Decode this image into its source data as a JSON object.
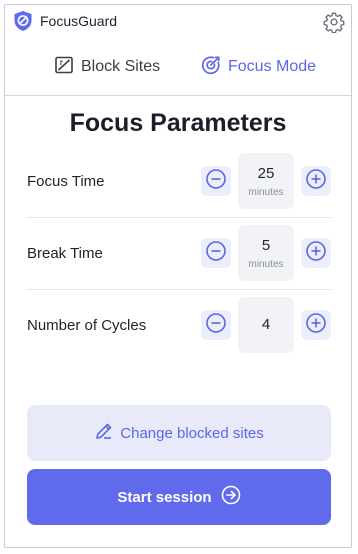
{
  "app": {
    "title": "FocusGuard"
  },
  "tabs": [
    {
      "label": "Block Sites",
      "icon": "block-sites-icon",
      "active": false
    },
    {
      "label": "Focus Mode",
      "icon": "focus-target-icon",
      "active": true
    }
  ],
  "section_title": "Focus Parameters",
  "params": [
    {
      "label": "Focus Time",
      "value": "25",
      "unit": "minutes"
    },
    {
      "label": "Break Time",
      "value": "5",
      "unit": "minutes"
    },
    {
      "label": "Number of Cycles",
      "value": "4",
      "unit": ""
    }
  ],
  "actions": {
    "change_sites_label": "Change blocked sites",
    "start_label": "Start session"
  },
  "colors": {
    "accent": "#5f6bea",
    "accent_soft": "#e8eafa",
    "text": "#1f2230"
  }
}
